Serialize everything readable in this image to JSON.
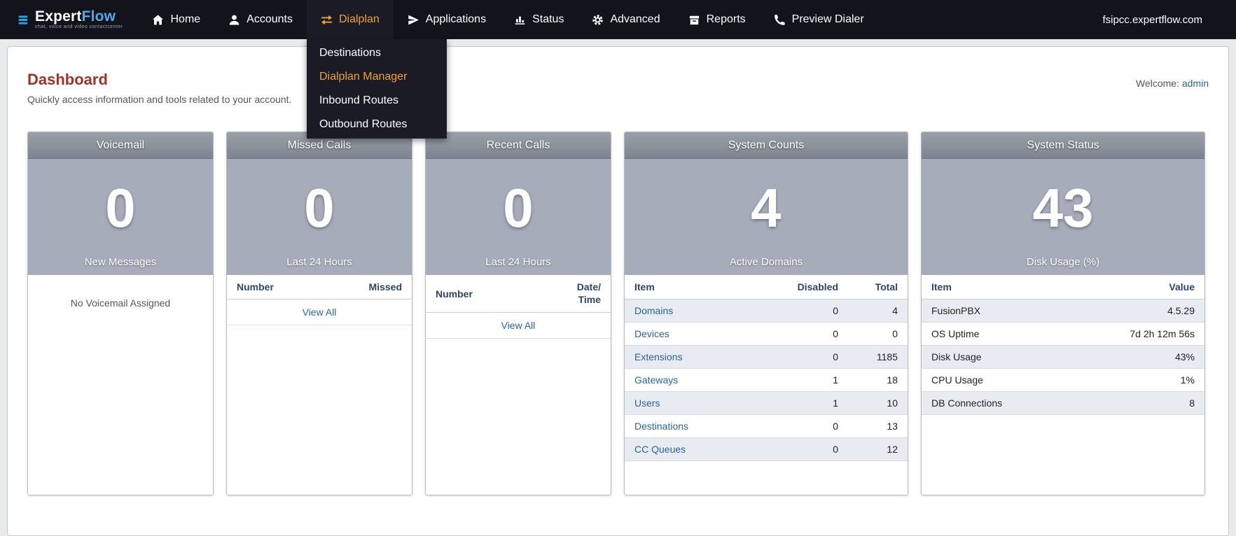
{
  "nav": {
    "logo": {
      "name_primary": "Expert",
      "name_secondary": "Flow",
      "tagline": "chat, voice and video contactcenter"
    },
    "items": [
      {
        "label": "Home"
      },
      {
        "label": "Accounts"
      },
      {
        "label": "Dialplan",
        "active": true
      },
      {
        "label": "Applications"
      },
      {
        "label": "Status"
      },
      {
        "label": "Advanced"
      },
      {
        "label": "Reports"
      },
      {
        "label": "Preview Dialer"
      }
    ],
    "dropdown": {
      "items": [
        {
          "label": "Destinations"
        },
        {
          "label": "Dialplan Manager",
          "active": true
        },
        {
          "label": "Inbound Routes"
        },
        {
          "label": "Outbound Routes"
        }
      ]
    },
    "domain": "fsipcc.expertflow.com"
  },
  "page": {
    "title": "Dashboard",
    "subtitle": "Quickly access information and tools related to your account.",
    "welcome_label": "Welcome:",
    "welcome_user": "admin"
  },
  "cards": {
    "voicemail": {
      "title": "Voicemail",
      "number": "0",
      "number_label": "New Messages",
      "empty_text": "No Voicemail Assigned"
    },
    "missed_calls": {
      "title": "Missed Calls",
      "number": "0",
      "number_label": "Last 24 Hours",
      "columns": [
        "Number",
        "Missed"
      ],
      "view_all": "View All"
    },
    "recent_calls": {
      "title": "Recent Calls",
      "number": "0",
      "number_label": "Last 24 Hours",
      "columns": [
        "Number",
        "Date/Time"
      ],
      "view_all": "View All"
    },
    "system_counts": {
      "title": "System Counts",
      "number": "4",
      "number_label": "Active Domains",
      "columns": [
        "Item",
        "Disabled",
        "Total"
      ],
      "rows": [
        [
          "Domains",
          "0",
          "4"
        ],
        [
          "Devices",
          "0",
          "0"
        ],
        [
          "Extensions",
          "0",
          "1185"
        ],
        [
          "Gateways",
          "1",
          "18"
        ],
        [
          "Users",
          "1",
          "10"
        ],
        [
          "Destinations",
          "0",
          "13"
        ],
        [
          "CC Queues",
          "0",
          "12"
        ]
      ]
    },
    "system_status": {
      "title": "System Status",
      "number": "43",
      "number_label": "Disk Usage (%)",
      "columns": [
        "Item",
        "Value"
      ],
      "rows": [
        [
          "FusionPBX",
          "4.5.29"
        ],
        [
          "OS Uptime",
          "7d 2h 12m 56s"
        ],
        [
          "Disk Usage",
          "43%"
        ],
        [
          "CPU Usage",
          "1%"
        ],
        [
          "DB Connections",
          "8"
        ]
      ]
    }
  },
  "colors": {
    "accent_orange": "#efa13a",
    "link_blue": "#2a6496",
    "title_red": "#a03226"
  }
}
